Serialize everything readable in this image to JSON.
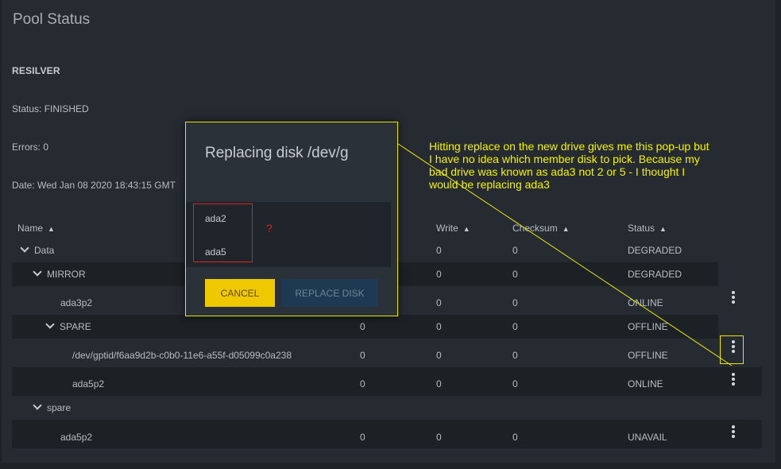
{
  "page": {
    "title": "Pool Status"
  },
  "resilver": {
    "title": "RESILVER",
    "status": "Status: FINISHED",
    "errors": "Errors: 0",
    "date": "Date: Wed Jan 08 2020 18:43:15 GMT"
  },
  "table": {
    "headers": [
      "Name",
      "Write",
      "Checksum",
      "Status"
    ],
    "rows": [
      {
        "name": "Data",
        "read": "",
        "write": "0",
        "checksum": "0",
        "status": "DEGRADED"
      },
      {
        "name": "MIRROR",
        "read": "",
        "write": "0",
        "checksum": "0",
        "status": "DEGRADED"
      },
      {
        "name": "ada3p2",
        "read": "",
        "write": "0",
        "checksum": "0",
        "status": "ONLINE"
      },
      {
        "name": "SPARE",
        "read": "0",
        "write": "0",
        "checksum": "0",
        "status": "OFFLINE"
      },
      {
        "name": "/dev/gptid/f6aa9d2b-c0b0-11e6-a55f-d05099c0a238",
        "read": "0",
        "write": "0",
        "checksum": "0",
        "status": "OFFLINE"
      },
      {
        "name": "ada5p2",
        "read": "0",
        "write": "0",
        "checksum": "0",
        "status": "ONLINE"
      },
      {
        "name": "spare",
        "read": "",
        "write": "",
        "checksum": "",
        "status": ""
      },
      {
        "name": "ada5p2",
        "read": "0",
        "write": "0",
        "checksum": "0",
        "status": "UNAVAIL"
      }
    ]
  },
  "dialog": {
    "title": "Replacing disk /dev/g",
    "options": [
      "ada2",
      "ada5"
    ],
    "cancel_label": "CANCEL",
    "replace_label": "REPLACE DISK"
  },
  "annotation": {
    "text": "Hitting replace on the new drive gives me this pop-up but I have no idea which member disk to pick.  Because my bad drive was known as ada3 not 2 or 5 - I thought I would be replacing ada3",
    "question_mark": "?"
  },
  "colors": {
    "accent": "#f0c800",
    "annotation": "#f2f200",
    "highlight": "#e0201b",
    "background": "#262b31"
  }
}
